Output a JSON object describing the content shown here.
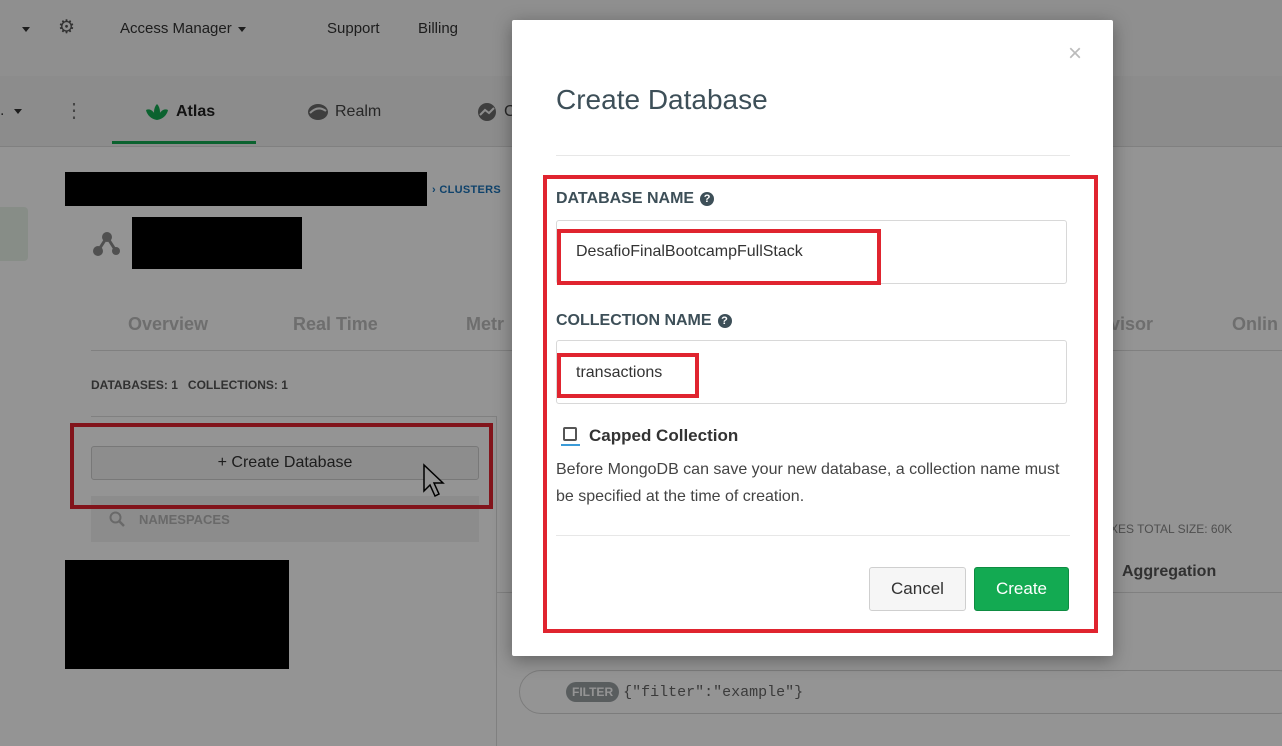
{
  "topnav": {
    "access_manager": "Access Manager",
    "support": "Support",
    "billing": "Billing"
  },
  "productnav": {
    "atlas": "Atlas",
    "realm": "Realm",
    "charts_partial": "C"
  },
  "breadcrumb": {
    "clusters": "› CLUSTERS"
  },
  "cluster_tabs": [
    "Overview",
    "Real Time",
    "Metr",
    "visor",
    "Onlin"
  ],
  "stats": {
    "databases": "DATABASES: 1",
    "collections": "COLLECTIONS: 1"
  },
  "sidebar": {
    "create_database_button": "+ Create Database",
    "namespaces_label": "NAMESPACES"
  },
  "collection_view": {
    "indexes_total_size": "XES TOTAL SIZE: 60K",
    "aggregation_tab": "Aggregation",
    "filter_pill": "FILTER",
    "filter_placeholder": "{\"filter\":\"example\"}"
  },
  "modal": {
    "title": "Create Database",
    "close_glyph": "×",
    "database_name_label": "DATABASE NAME",
    "database_name_value": "DesafioFinalBootcampFullStack",
    "collection_name_label": "COLLECTION NAME",
    "collection_name_value": "transactions",
    "capped_collection_label": "Capped Collection",
    "help_text": "Before MongoDB can save your new database, a collection name must be specified at the time of creation.",
    "cancel_label": "Cancel",
    "create_label": "Create"
  },
  "colors": {
    "accent_green": "#13aa52",
    "annotation_red": "#e0242f",
    "link_blue": "#1a73b8"
  }
}
